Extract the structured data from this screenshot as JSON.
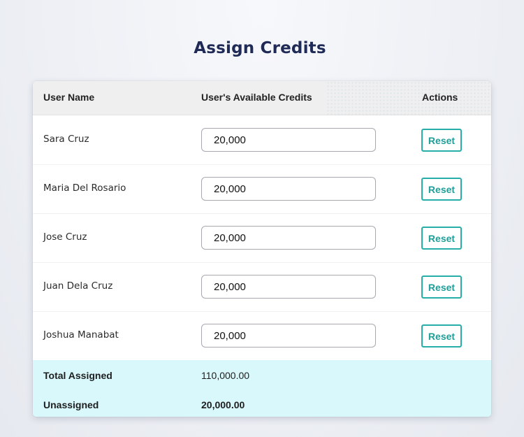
{
  "page": {
    "title": "Assign Credits"
  },
  "table": {
    "headers": {
      "user_name": "User Name",
      "credits": "User's Available Credits",
      "actions": "Actions"
    },
    "rows": [
      {
        "name": "Sara Cruz",
        "credits": "20,000",
        "action_label": "Reset"
      },
      {
        "name": "Maria Del Rosario",
        "credits": "20,000",
        "action_label": "Reset"
      },
      {
        "name": "Jose Cruz",
        "credits": "20,000",
        "action_label": "Reset"
      },
      {
        "name": "Juan Dela Cruz",
        "credits": "20,000",
        "action_label": "Reset"
      },
      {
        "name": "Joshua Manabat",
        "credits": "20,000",
        "action_label": "Reset"
      }
    ]
  },
  "summary": {
    "total_label": "Total Assigned",
    "total_value": "110,000.00",
    "unassigned_label": "Unassigned",
    "unassigned_value": "20,000.00"
  },
  "colors": {
    "title": "#1f2a56",
    "accent": "#27aea9",
    "summary_background": "#d9f8fb",
    "header_background": "#efefef"
  }
}
